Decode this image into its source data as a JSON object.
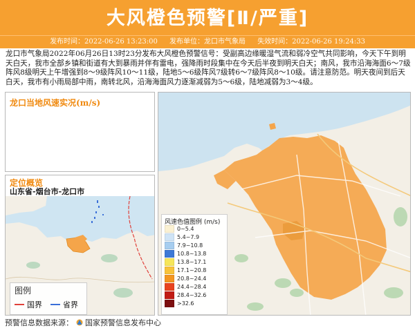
{
  "header": {
    "title": "大风橙色预警[Ⅱ/严重]",
    "publish_time": "发布时间：2022-06-26 13:23:00",
    "publisher": "发布单位：龙口市气象局",
    "expire_time": "失效时间：2022-06-26 19:24:33"
  },
  "description": "龙口市气象局2022年06月26日13时23分发布大风橙色预警信号：受副高边缘暖湿气流和弱冷空气共同影响，今天下午到明天白天，我市全部乡镇和街道有大到暴雨并伴有雷电，强降雨时段集中在今天后半夜到明天白天；南风，我市沿海海面6～7级阵风8级明天上午增强到8～9级阵风10～11级，陆地5～6级阵风7级转6～7级阵风8～10级。请注意防范。明天夜间到后天白天，我市有小雨局部中雨，南转北风，沿海海面风力逐渐减弱为5～6级，陆地减弱为3～4级。",
  "wind_panel": {
    "title": "龙口当地风速实况(m/s)"
  },
  "location_panel": {
    "title": "定位概览",
    "path": "山东省-烟台市-龙口市",
    "legend": {
      "title": "图例",
      "items": [
        {
          "label": "国界",
          "color": "#e0403a"
        },
        {
          "label": "省界",
          "color": "#3a6fd8"
        }
      ]
    }
  },
  "wind_legend": {
    "title": "风速色值图例 (m/s)",
    "items": [
      {
        "label": "0~5.4",
        "color": "#fbf1d2"
      },
      {
        "label": "5.4~7.9",
        "color": "#cfe4f6"
      },
      {
        "label": "7.9~10.8",
        "color": "#a6cdef"
      },
      {
        "label": "10.8~13.8",
        "color": "#3d79d6"
      },
      {
        "label": "13.8~17.1",
        "color": "#f6e65a"
      },
      {
        "label": "17.1~20.8",
        "color": "#f8c33a"
      },
      {
        "label": "20.8~24.4",
        "color": "#f49620"
      },
      {
        "label": "24.4~28.4",
        "color": "#e8431e"
      },
      {
        "label": "28.4~32.6",
        "color": "#c11b14"
      },
      {
        "label": ">32.6",
        "color": "#7d0f10"
      }
    ]
  },
  "footer": {
    "prefix": "预警信息数据来源：",
    "source": "国家预警信息发布中心"
  },
  "colors": {
    "banner": "#f6a030",
    "warning_area": "#f5a54a",
    "sea": "#cde3f0"
  }
}
